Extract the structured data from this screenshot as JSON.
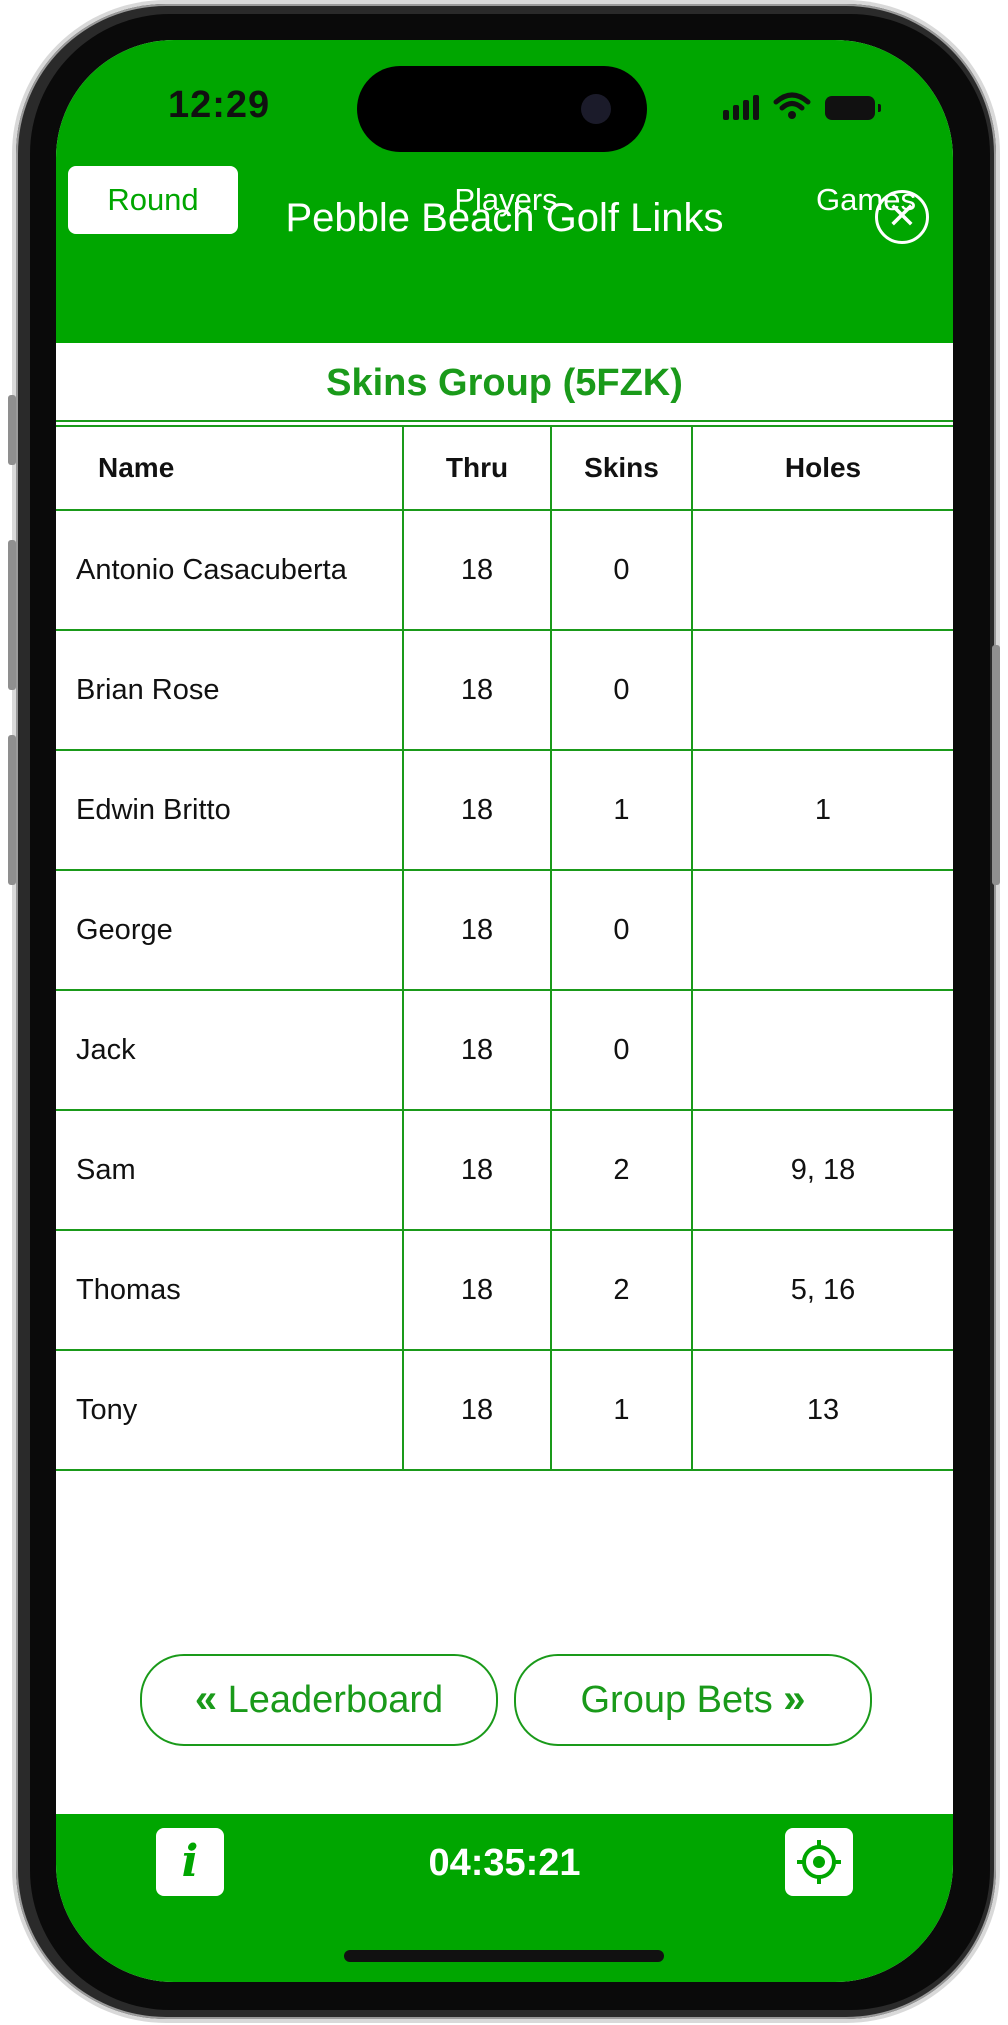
{
  "status_bar": {
    "time": "12:29"
  },
  "header": {
    "title": "Pebble Beach Golf Links",
    "tabs": [
      {
        "label": "Round",
        "active": true
      },
      {
        "label": "Players",
        "active": false
      },
      {
        "label": "Games",
        "active": false
      }
    ]
  },
  "group_title": "Skins Group (5FZK)",
  "table": {
    "columns": [
      "Name",
      "Thru",
      "Skins",
      "Holes"
    ],
    "rows": [
      {
        "name": "Antonio Casacuberta",
        "thru": "18",
        "skins": "0",
        "holes": ""
      },
      {
        "name": "Brian Rose",
        "thru": "18",
        "skins": "0",
        "holes": ""
      },
      {
        "name": "Edwin Britto",
        "thru": "18",
        "skins": "1",
        "holes": "1"
      },
      {
        "name": "George",
        "thru": "18",
        "skins": "0",
        "holes": ""
      },
      {
        "name": "Jack",
        "thru": "18",
        "skins": "0",
        "holes": ""
      },
      {
        "name": "Sam",
        "thru": "18",
        "skins": "2",
        "holes": "9, 18"
      },
      {
        "name": "Thomas",
        "thru": "18",
        "skins": "2",
        "holes": "5, 16"
      },
      {
        "name": "Tony",
        "thru": "18",
        "skins": "1",
        "holes": "13"
      }
    ]
  },
  "buttons": {
    "prev_label": "Leaderboard",
    "next_label": "Group Bets"
  },
  "footer": {
    "timer": "04:35:21"
  },
  "colors": {
    "accent": "#00a600",
    "text_green": "#1a9a1a"
  },
  "icons": [
    "menu-icon",
    "close-icon",
    "chevron-left-icon",
    "chevron-right-icon",
    "info-icon",
    "location-target-icon"
  ]
}
